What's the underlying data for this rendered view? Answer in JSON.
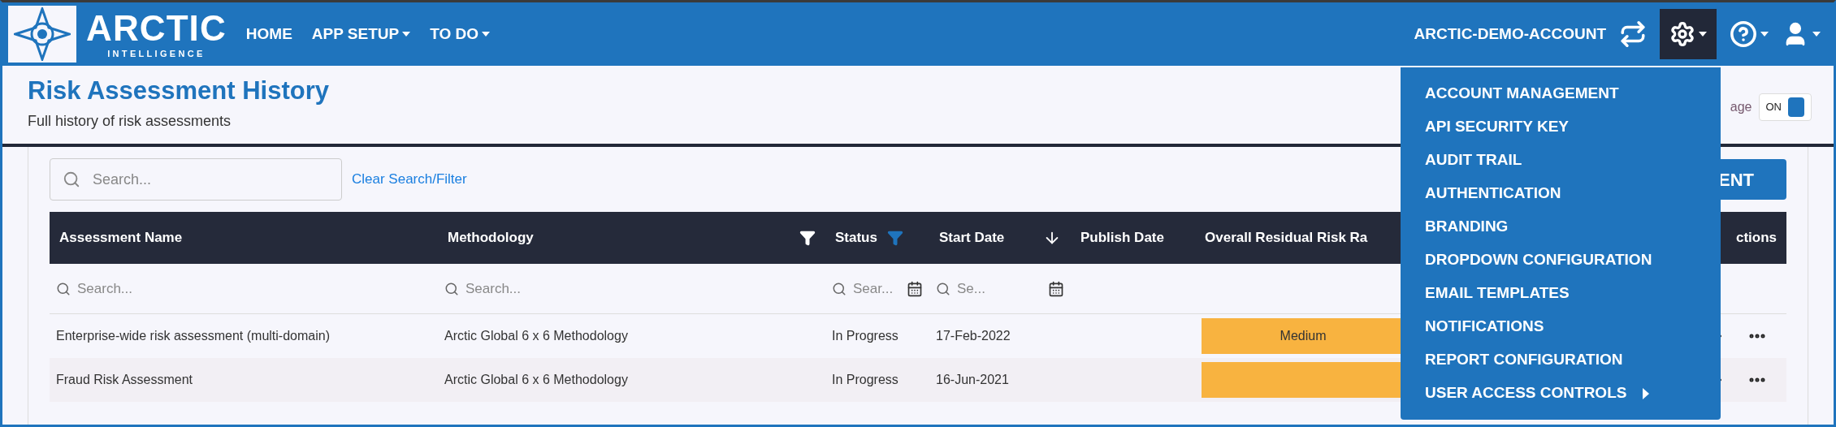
{
  "navbar": {
    "logo": {
      "name": "ARCTIC",
      "tagline": "INTELLIGENCE"
    },
    "items": [
      {
        "label": "HOME",
        "dropdown": false
      },
      {
        "label": "APP SETUP",
        "dropdown": true
      },
      {
        "label": "TO DO",
        "dropdown": true
      }
    ],
    "account": "ARCTIC-DEMO-ACCOUNT",
    "settings_expanded": true
  },
  "page": {
    "title": "Risk Assessment History",
    "subtitle": "Full history of risk assessments",
    "toggle": {
      "label": "age",
      "text": "ON",
      "on": true
    }
  },
  "toolbar": {
    "search": {
      "placeholder": "Search..."
    },
    "clear_link": "Clear Search/Filter",
    "new_button": "ENT"
  },
  "table": {
    "columns": [
      {
        "label": "Assessment Name",
        "filter": false,
        "sorted": false
      },
      {
        "label": "Methodology",
        "filter": true,
        "filter_active": false,
        "sorted": false
      },
      {
        "label": "Status",
        "filter": true,
        "filter_active": true,
        "sorted": false
      },
      {
        "label": "Start Date",
        "filter": false,
        "sorted": true
      },
      {
        "label": "Publish Date",
        "filter": false,
        "sorted": false
      },
      {
        "label": "Overall Residual Risk Ra",
        "filter": false,
        "sorted": false
      }
    ],
    "actions_header": "ctions",
    "filters": [
      {
        "kind": "text",
        "placeholder": "Search..."
      },
      {
        "kind": "text",
        "placeholder": "Search..."
      },
      {
        "kind": "date",
        "placeholder": "Sear..."
      },
      {
        "kind": "date",
        "placeholder": "Se..."
      }
    ],
    "rows": [
      {
        "name": "Enterprise-wide risk assessment (multi-domain)",
        "methodology": "Arctic Global 6 x 6 Methodology",
        "status": "In Progress",
        "start": "17-Feb-2022",
        "rating": {
          "text": "Medium",
          "color": "#f8b340"
        }
      },
      {
        "name": "Fraud Risk Assessment",
        "methodology": "Arctic Global 6 x 6 Methodology",
        "status": "In Progress",
        "start": "16-Jun-2021",
        "rating": {
          "color": "#f8b340"
        }
      }
    ]
  },
  "settings_menu": {
    "items": [
      {
        "label": "ACCOUNT MANAGEMENT",
        "submenu": false
      },
      {
        "label": "API SECURITY KEY",
        "submenu": false
      },
      {
        "label": "AUDIT TRAIL",
        "submenu": false
      },
      {
        "label": "AUTHENTICATION",
        "submenu": false
      },
      {
        "label": "BRANDING",
        "submenu": false
      },
      {
        "label": "DROPDOWN CONFIGURATION",
        "submenu": false
      },
      {
        "label": "EMAIL TEMPLATES",
        "submenu": false
      },
      {
        "label": "NOTIFICATIONS",
        "submenu": false
      },
      {
        "label": "REPORT CONFIGURATION",
        "submenu": false
      },
      {
        "label": "USER ACCESS CONTROLS",
        "submenu": true
      }
    ]
  }
}
